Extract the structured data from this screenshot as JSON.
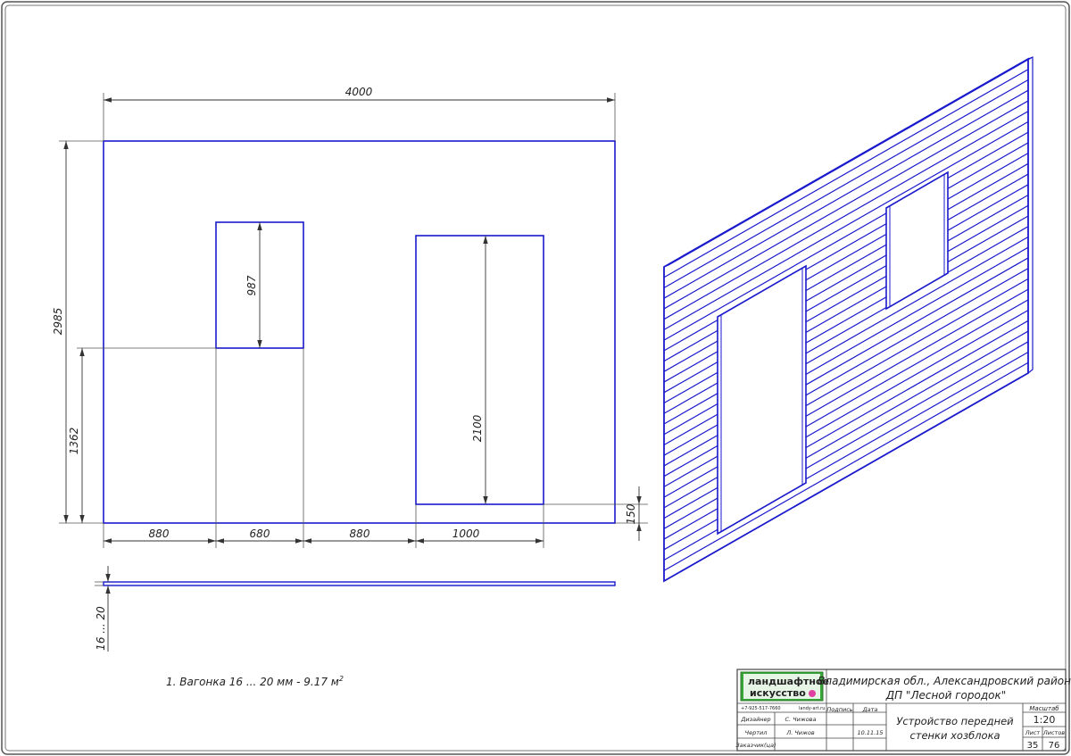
{
  "dimensions": {
    "width": "4000",
    "height": "2985",
    "window_height": "987",
    "window_sill": "1362",
    "door_height": "2100",
    "door_offset": "150",
    "seg1": "880",
    "seg2": "680",
    "seg3": "880",
    "seg4": "1000",
    "thickness": "16 ... 20"
  },
  "note": {
    "text": "1. Вагонка 16 ... 20 мм - 9.17 м",
    "sup": "2"
  },
  "title_block": {
    "logo_line1": "ландшафтное",
    "logo_line2": "искусство",
    "phone": "+7-925-517-7660",
    "site": "landy-art.ru",
    "location": "Владимирская обл., Александровский район,",
    "project": "ДП \"Лесной городок\"",
    "sign_header": "Подпись",
    "date_header": "Дата",
    "scale_header": "Масштаб",
    "scale": "1:20",
    "drawing_title_1": "Устройство передней",
    "drawing_title_2": "стенки хозблока",
    "sheet_header": "Лист",
    "sheets_header": "Листов",
    "sheet": "35",
    "sheets": "76",
    "rows": [
      {
        "role": "Дизайнер",
        "name": "С. Чижова",
        "date": ""
      },
      {
        "role": "Чертил",
        "name": "Л. Чижов",
        "date": "10.11.15"
      },
      {
        "role": "Заказчик(ца)",
        "name": "",
        "date": ""
      }
    ]
  },
  "colors": {
    "line": "#1a1acc",
    "dim": "#333333",
    "logo_green": "#3aa63a",
    "logo_dot": "#e040a0"
  }
}
